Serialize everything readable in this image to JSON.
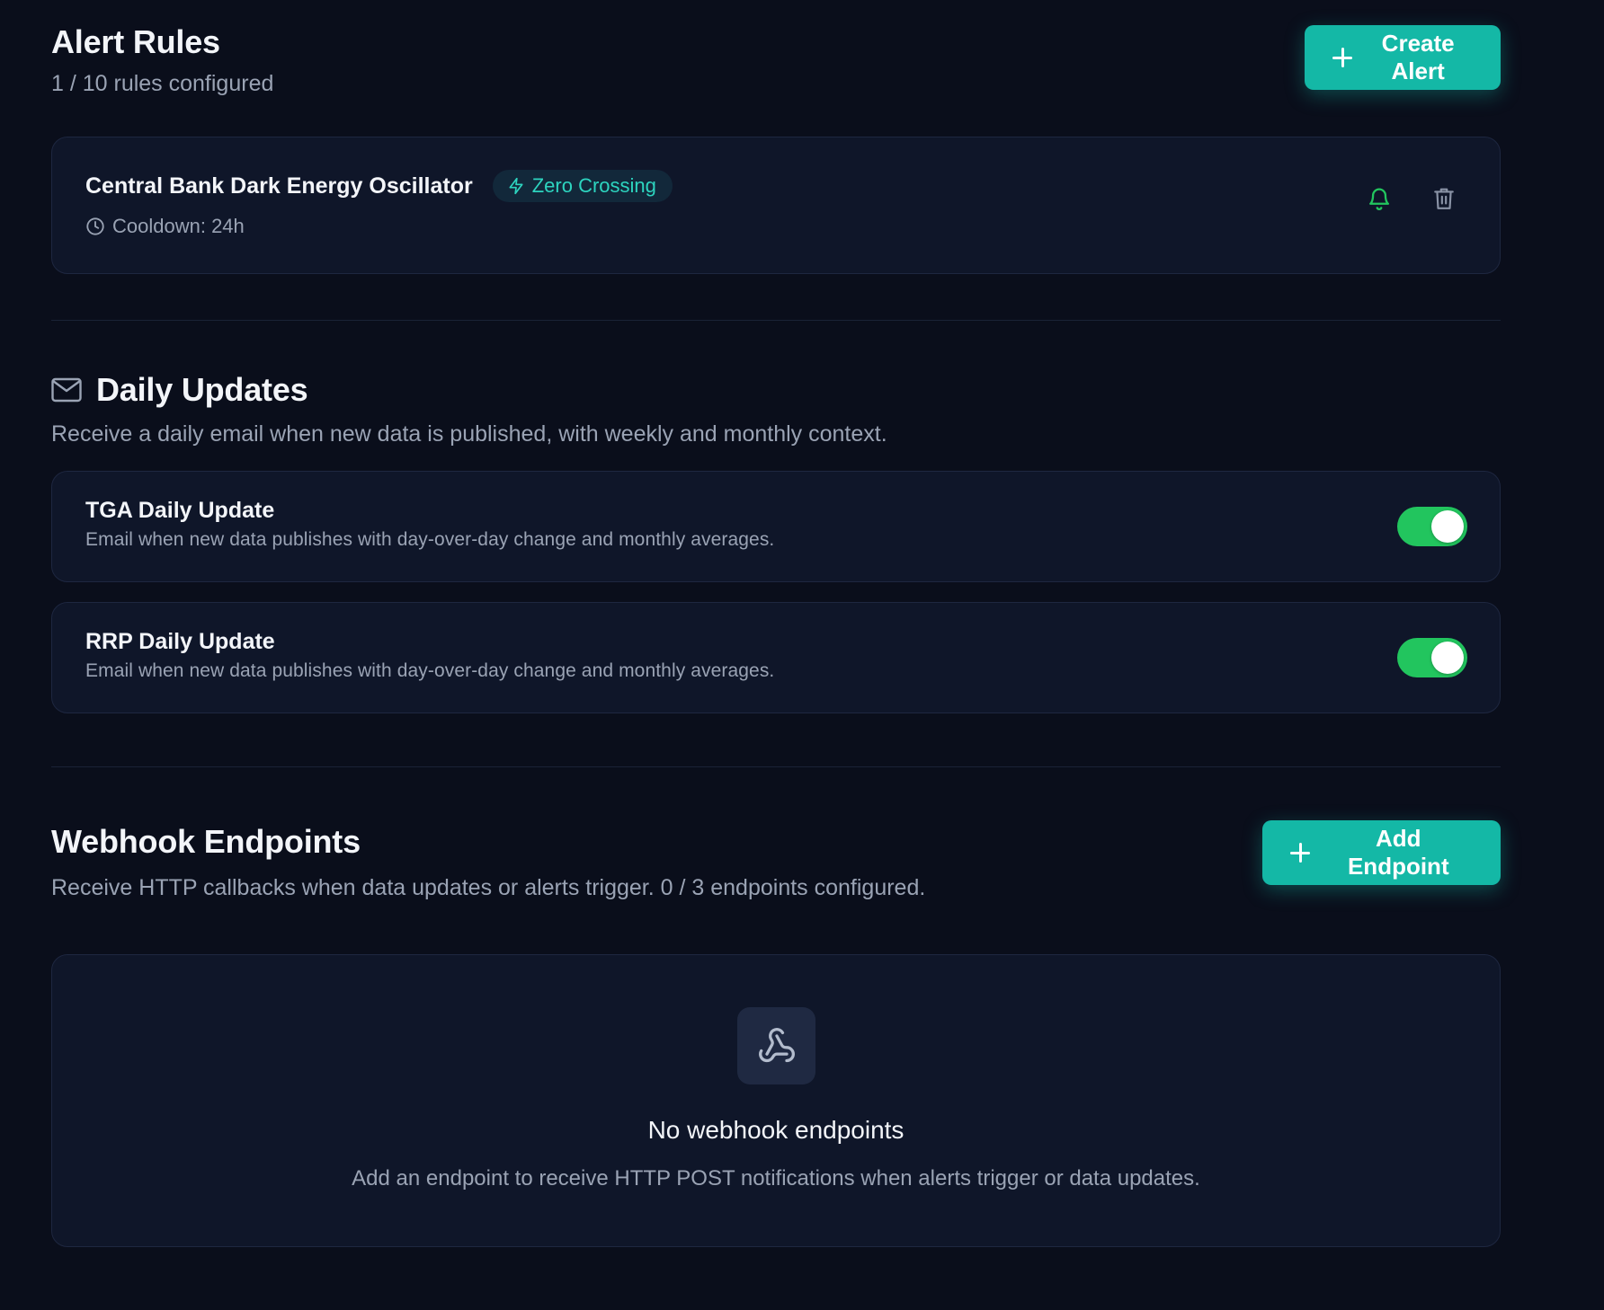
{
  "alert_rules": {
    "title": "Alert Rules",
    "subtitle": "1 / 10 rules configured",
    "create_label": "Create Alert",
    "rules": [
      {
        "name": "Central Bank Dark Energy Oscillator",
        "badge": "Zero Crossing",
        "cooldown": "Cooldown: 24h"
      }
    ]
  },
  "daily_updates": {
    "title": "Daily Updates",
    "description": "Receive a daily email when new data is published, with weekly and monthly context.",
    "items": [
      {
        "title": "TGA Daily Update",
        "description": "Email when new data publishes with day-over-day change and monthly averages.",
        "enabled": true
      },
      {
        "title": "RRP Daily Update",
        "description": "Email when new data publishes with day-over-day change and monthly averages.",
        "enabled": true
      }
    ]
  },
  "webhooks": {
    "title": "Webhook Endpoints",
    "description": "Receive HTTP callbacks when data updates or alerts trigger. 0 / 3 endpoints configured.",
    "add_label": "Add Endpoint",
    "empty_title": "No webhook endpoints",
    "empty_description": "Add an endpoint to receive HTTP POST notifications when alerts trigger or data updates."
  },
  "colors": {
    "background": "#0a0e1b",
    "card": "#0f1629",
    "accent": "#14b8a6",
    "toggle_on": "#22c55e",
    "badge_text": "#2dd4bf"
  }
}
